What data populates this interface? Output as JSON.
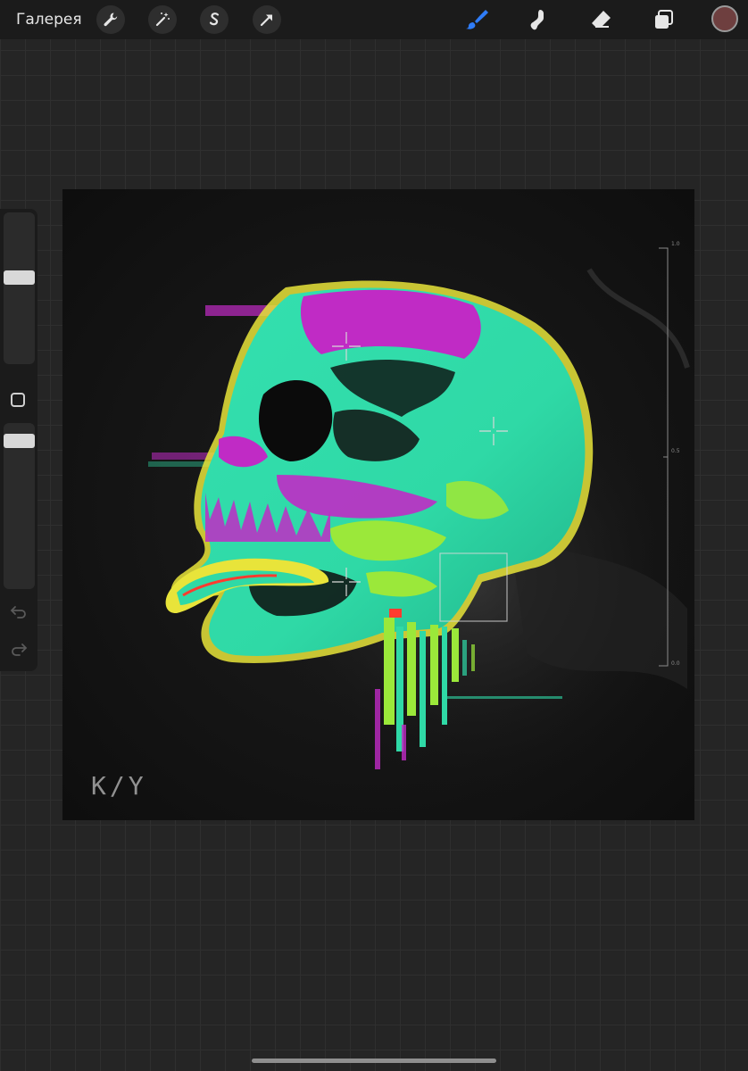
{
  "toolbar": {
    "gallery_label": "Галерея",
    "left_tools": [
      {
        "icon": "wrench-icon"
      },
      {
        "icon": "magic-wand-icon"
      },
      {
        "icon": "selection-s-icon"
      },
      {
        "icon": "transform-arrow-icon"
      }
    ],
    "right_tools": [
      {
        "icon": "brush-icon",
        "active": true
      },
      {
        "icon": "smudge-icon",
        "active": false
      },
      {
        "icon": "eraser-icon",
        "active": false
      },
      {
        "icon": "layers-icon",
        "active": false
      }
    ],
    "current_color": "#6e3f3f",
    "accent_color": "#2f7cf6"
  },
  "sidebar": {
    "brush_size_level": 0.58,
    "opacity_level": 0.93,
    "modifier_icon": "square-icon",
    "undo_icon": "undo-icon",
    "redo_icon": "redo-icon"
  },
  "artwork": {
    "signature": "K/Y",
    "palette": [
      "#2fd9a6",
      "#c02bc5",
      "#9be83a",
      "#e8e43a",
      "#ff3b2f"
    ],
    "hud_scale_top": "1.0",
    "hud_scale_mid": "0.5",
    "hud_scale_bottom": "0.0"
  }
}
